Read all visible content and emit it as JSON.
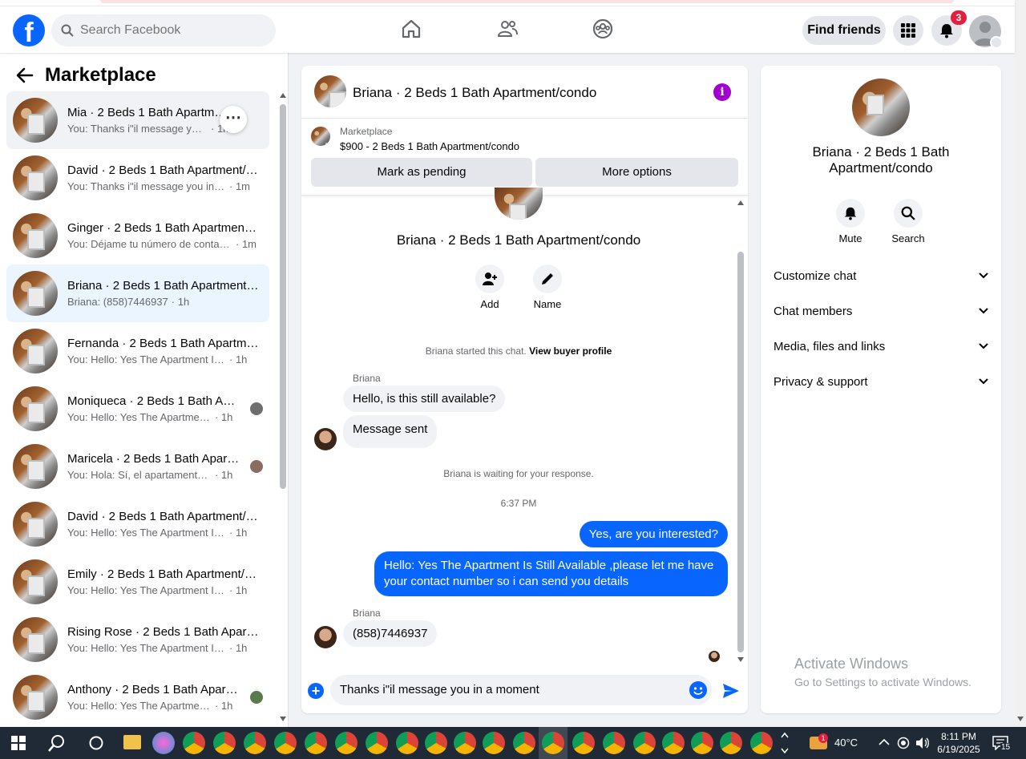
{
  "topbar": {
    "search_placeholder": "Search Facebook",
    "find_friends": "Find friends",
    "notification_count": "3"
  },
  "left": {
    "title": "Marketplace",
    "conversations": [
      {
        "name": "Mia · 2 Beds 1 Bath Apartment/condo",
        "preview": "You: Thanks i\"il message you in a moment",
        "time": "1m"
      },
      {
        "name": "David · 2 Beds 1 Bath Apartment/condo",
        "preview": "You: Thanks i\"il message you in a moment",
        "time": "1m"
      },
      {
        "name": "Ginger · 2 Beds 1 Bath Apartment/condo",
        "preview": "You: Déjame tu número de contacto",
        "time": "1m"
      },
      {
        "name": "Briana · 2 Beds 1 Bath Apartment/condo",
        "preview": "Briana: (858)7446937",
        "time": "1h"
      },
      {
        "name": "Fernanda · 2 Beds 1 Bath Apartment/condo",
        "preview": "You: Hello: Yes The Apartment Is Still Available",
        "time": "1h"
      },
      {
        "name": "Moniqueca · 2 Beds 1 Bath Apartment/condo",
        "preview": "You: Hello: Yes The Apartment Is Still Available",
        "time": "1h"
      },
      {
        "name": "Maricela · 2 Beds 1 Bath Apartment/condo",
        "preview": "You: Hola: Sí, el apartamento todavía está disponible",
        "time": "1h"
      },
      {
        "name": "David · 2 Beds 1 Bath Apartment/condo",
        "preview": "You: Hello: Yes The Apartment Is Still Available",
        "time": "1h"
      },
      {
        "name": "Emily · 2 Beds 1 Bath Apartment/condo",
        "preview": "You: Hello: Yes The Apartment Is Still Available",
        "time": "1h"
      },
      {
        "name": "Rising Rose · 2 Beds 1 Bath Apartment/condo",
        "preview": "You: Hello: Yes The Apartment Is Still Available",
        "time": "1h"
      },
      {
        "name": "Anthony · 2 Beds 1 Bath Apartment/condo",
        "preview": "You: Hello: Yes The Apartment Is Still Available",
        "time": "1h"
      }
    ]
  },
  "chat": {
    "title": "Briana · 2 Beds 1 Bath Apartment/condo",
    "marketplace_label": "Marketplace",
    "listing": "$900 - 2 Beds 1 Bath Apartment/condo",
    "mark_pending": "Mark as pending",
    "more_options": "More options",
    "profile_name": "Briana · 2 Beds 1 Bath Apartment/condo",
    "add_label": "Add",
    "name_label": "Name",
    "started_text": "Briana started this chat.",
    "view_buyer": "View buyer profile",
    "sender": "Briana",
    "msg1": "Hello, is this still available?",
    "msg2": "Message sent",
    "waiting": "Briana is waiting for your response.",
    "time": "6:37 PM",
    "out1": "Yes, are you interested?",
    "out2": "Hello: Yes The Apartment Is Still Available ,please let me have your contact number so i can send you details",
    "sender2": "Briana",
    "msg3": "(858)7446937",
    "composer_value": "Thanks i\"il message you in a moment"
  },
  "right": {
    "name": "Briana · 2 Beds 1 Bath Apartment/condo",
    "mute": "Mute",
    "search": "Search",
    "sections": [
      "Customize chat",
      "Chat members",
      "Media, files and links",
      "Privacy & support"
    ]
  },
  "watermark": {
    "line1": "Activate Windows",
    "line2": "Go to Settings to activate Windows."
  },
  "taskbar": {
    "temperature": "40°C",
    "weather_badge": "1",
    "time": "8:11 PM",
    "date": "6/19/2025",
    "notifications": "15"
  },
  "colors": {
    "brand": "#0866ff",
    "badge": "#e41e3f",
    "info": "#a100ce"
  }
}
